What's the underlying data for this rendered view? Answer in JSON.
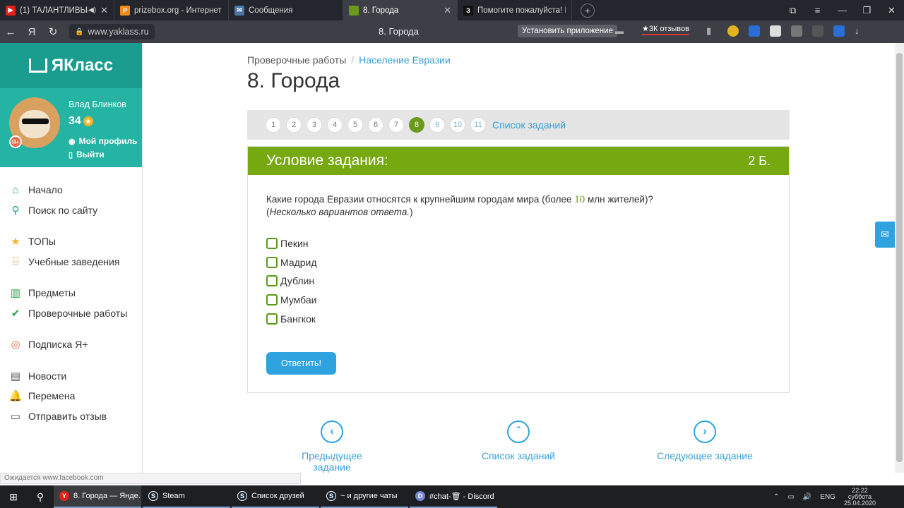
{
  "browser": {
    "tabs": [
      {
        "title": "(1) ТАЛАНТЛИВЫЕ /",
        "favicon": "youtube-icon",
        "color": "#e62117"
      },
      {
        "title": "prizebox.org - Интернет м",
        "favicon": "prizebox-icon",
        "color": "#f28b1a"
      },
      {
        "title": "Сообщения",
        "favicon": "vk-messages-icon",
        "color": "#4a76a8"
      },
      {
        "title": "8. Города",
        "favicon": "yaklass-icon",
        "color": "#6a9a1a",
        "active": true
      },
      {
        "title": "Помогите пожалуйста! Бе",
        "favicon": "znanija-icon",
        "color": "#111"
      }
    ],
    "url": "www.yaklass.ru",
    "page_title": "8. Города",
    "install_button": "Установить приложение",
    "reviews_badge": "★3К отзывов",
    "status_text": "Ожидается www.facebook.com"
  },
  "site": {
    "brand": "ЯКласс",
    "user": {
      "name": "Влад Блинков",
      "points": "34",
      "profile_link": "Мой профиль",
      "logout_link": "Выйти",
      "badge": "Я+"
    },
    "menu": [
      {
        "label": "Начало",
        "icon": "home-icon",
        "color": "#1a9d8f"
      },
      {
        "label": "Поиск по сайту",
        "icon": "search-icon",
        "color": "#1a9d8f"
      },
      {
        "label": "ТОПы",
        "icon": "star-icon",
        "color": "#f4b52a"
      },
      {
        "label": "Учебные заведения",
        "icon": "school-icon",
        "color": "#c99a2e"
      },
      {
        "label": "Предметы",
        "icon": "books-icon",
        "color": "#2e9e4e"
      },
      {
        "label": "Проверочные работы",
        "icon": "check-circle-icon",
        "color": "#2e9e4e"
      },
      {
        "label": "Подписка Я+",
        "icon": "subscription-icon",
        "color": "#e86a4a"
      },
      {
        "label": "Новости",
        "icon": "news-icon",
        "color": "#555"
      },
      {
        "label": "Перемена",
        "icon": "bell-icon",
        "color": "#555"
      },
      {
        "label": "Отправить отзыв",
        "icon": "feedback-icon",
        "color": "#555"
      }
    ]
  },
  "main": {
    "breadcrumb": {
      "root": "Проверочные работы",
      "separator": "/",
      "current": "Население Евразии"
    },
    "title": "8. Города",
    "pager": {
      "pages": [
        "1",
        "2",
        "3",
        "4",
        "5",
        "6",
        "7",
        "8",
        "9",
        "10",
        "11"
      ],
      "active": "8",
      "list_link": "Список заданий"
    },
    "task": {
      "header": "Условие задания:",
      "score": "2 Б.",
      "question_before": "Какие города Евразии относятся к крупнейшим городам мира (более ",
      "question_number": "10",
      "question_after": " млн жителей)?",
      "hint_open": "(",
      "hint": "Несколько вариантов ответа.",
      "hint_close": ")",
      "options": [
        "Пекин",
        "Мадрид",
        "Дублин",
        "Мумбаи",
        "Бангкок"
      ],
      "submit": "Ответить!"
    },
    "footer_nav": {
      "prev": "Предыдущее задание",
      "list": "Список заданий",
      "next": "Следующее задание"
    }
  },
  "taskbar": {
    "items": [
      {
        "label": "8. Города — Янде...",
        "icon": "yandex-browser-icon",
        "color": "#e62117"
      },
      {
        "label": "Steam",
        "icon": "steam-icon",
        "color": "#1b2838"
      },
      {
        "label": "Список друзей",
        "icon": "steam-icon",
        "color": "#1b2838"
      },
      {
        "label": "~ и другие чаты",
        "icon": "steam-icon",
        "color": "#1b2838"
      },
      {
        "label": "#chat-🗑 - Discord",
        "icon": "discord-icon",
        "color": "#7289da"
      }
    ],
    "lang": "ENG",
    "time": "22:22",
    "day": "суббота",
    "date": "25.04.2020"
  }
}
